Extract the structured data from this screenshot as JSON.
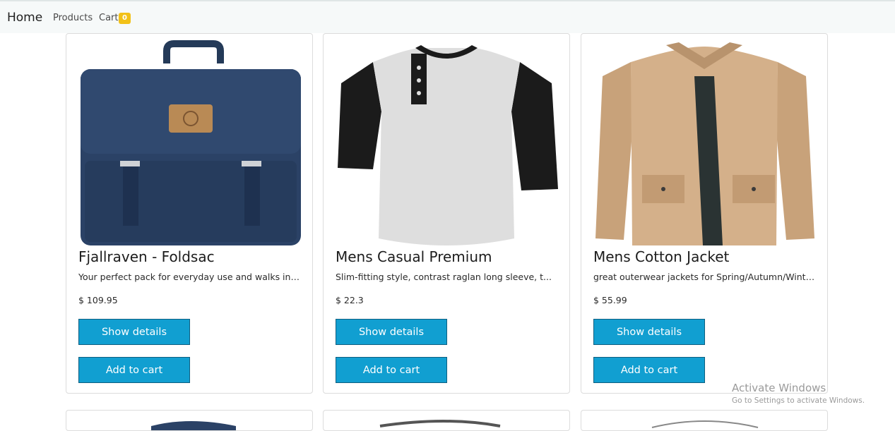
{
  "nav": {
    "brand": "Home",
    "products": "Products",
    "cart": "Cart",
    "cart_count": "0"
  },
  "products": [
    {
      "title": "Fjallraven - Foldsac",
      "description": "Your perfect pack for everyday use and walks in th...",
      "price": "$ 109.95",
      "details_label": "Show details",
      "cart_label": "Add to cart"
    },
    {
      "title": "Mens Casual Premium",
      "description": "Slim-fitting style, contrast raglan long sleeve, t...",
      "price": "$ 22.3",
      "details_label": "Show details",
      "cart_label": "Add to cart"
    },
    {
      "title": "Mens Cotton Jacket",
      "description": "great outerwear jackets for Spring/Autumn/Winter, ...",
      "price": "$ 55.99",
      "details_label": "Show details",
      "cart_label": "Add to cart"
    }
  ],
  "watermark": {
    "title": "Activate Windows",
    "subtitle": "Go to Settings to activate Windows."
  },
  "colors": {
    "accent": "#119fd1",
    "badge": "#f2c118",
    "navbar": "#f6f9f9"
  }
}
